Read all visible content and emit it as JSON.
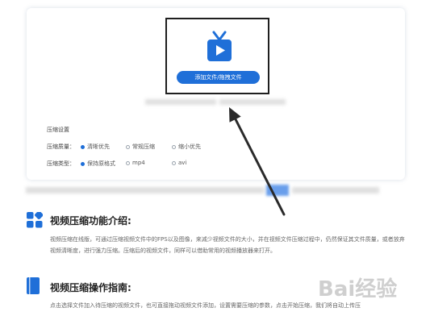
{
  "upload": {
    "button_label": "添加文件/拖拽文件"
  },
  "settings": {
    "title": "压缩设置",
    "quality_label": "压缩质量：",
    "quality_options": [
      "清晰优先",
      "常规压缩",
      "缩小优先"
    ],
    "quality_selected": "清晰优先",
    "type_label": "压缩类型：",
    "type_options": [
      "保持原格式",
      "mp4",
      "avi"
    ],
    "type_selected": "保持原格式"
  },
  "intro": {
    "title": "视频压缩功能介绍:",
    "text": "视频压缩在线版，可通过压缩视频文件中的FPS以及图像，来减少视频文件的大小，并在视频文件压缩过程中，仍然保证其文件质量，或者放弃视频清晰度，进行强力压缩。压缩后的视频文件，同样可以借助常用的视频播放器来打开。"
  },
  "guide": {
    "title": "视频压缩操作指南:",
    "text": "点击选择文件加入待压缩的视频文件，也可直接拖动视频文件添加，设置需要压缩的参数，点击开始压缩，我们将自动上传压"
  },
  "watermark": {
    "text": "Bai经验"
  },
  "colors": {
    "accent": "#1f6fd8",
    "annotation": "#2a2a2a"
  }
}
